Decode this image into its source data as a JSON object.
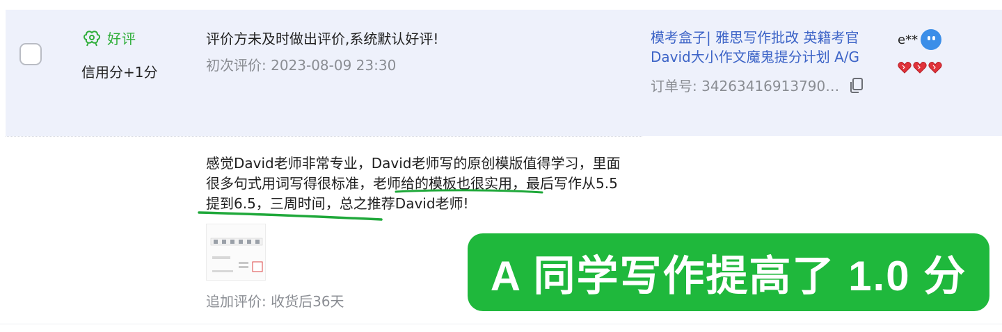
{
  "review": {
    "rating_label": "好评",
    "credit": "信用分+1分",
    "text": "评价方未及时做出评价,系统默认好评!",
    "date": "初次评价: 2023-08-09 23:30"
  },
  "product": {
    "title_line1": "模考盒子| 雅思写作批改 英籍考官",
    "title_line2": "David大小作文魔鬼提分计划 A/G",
    "order_no": "订单号: 34263416913790…"
  },
  "buyer": {
    "name": "e**",
    "level_hearts": 3
  },
  "followup": {
    "text_part1": "感觉David老师非常专业，David老师写的原创模版值得学习，里面很多句式用词写得很标准，",
    "highlight1": "老师给的模板也很实用",
    "text_part2": "，最后写作",
    "highlight2": "从5.5提到6.5，",
    "text_part3": "三周时间，总之推荐David老师!",
    "meta": "追加评价: 收货后36天"
  },
  "banner": {
    "text": "A 同学写作提高了 1.0 分"
  },
  "colors": {
    "accent_green": "#1fb83c",
    "rating_green": "#2fae3a",
    "link_blue": "#3d64c7",
    "row_bg": "#eef1fb",
    "heart_red": "#e0323a"
  },
  "icons": {
    "rating": "flower-icon",
    "copy": "copy-icon",
    "avatar": "buyer-avatar-icon",
    "hearts": "heart-icon"
  }
}
